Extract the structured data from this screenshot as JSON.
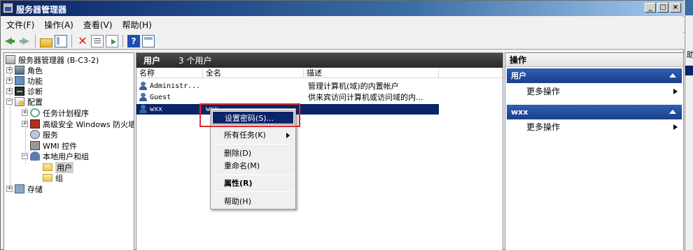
{
  "window": {
    "title": "服务器管理器",
    "buttons": [
      "_",
      "□",
      "×"
    ]
  },
  "menu": [
    "文件(F)",
    "操作(A)",
    "查看(V)",
    "帮助(H)"
  ],
  "toolbar": {
    "icons": [
      "back-icon",
      "forward-icon",
      "up-folder-icon",
      "show-tree-icon",
      "delete-icon",
      "properties-icon",
      "export-list-icon",
      "help-icon",
      "mmc-icon"
    ],
    "help_glyph": "?",
    "delete_glyph": "✕"
  },
  "tree": {
    "root": "服务器管理器 (B-C3-2)",
    "roles": "角色",
    "features": "功能",
    "diagnostics": "诊断",
    "configuration": "配置",
    "task_scheduler": "任务计划程序",
    "firewall": "高级安全 Windows 防火墙",
    "services": "服务",
    "wmi": "WMI 控件",
    "local_users": "本地用户和组",
    "users": "用户",
    "groups": "组",
    "storage": "存储",
    "expand_plus": "+",
    "expand_minus": "−"
  },
  "center": {
    "title": "用户",
    "count": "3 个用户",
    "columns": [
      "名称",
      "全名",
      "描述"
    ],
    "rows": [
      {
        "name": "Administr...",
        "full_name": "",
        "description": "管理计算机(域)的内置帐户"
      },
      {
        "name": "Guest",
        "full_name": "",
        "description": "供来宾访问计算机或访问域的内..."
      },
      {
        "name": "wxx",
        "full_name": "wxx",
        "description": ""
      }
    ]
  },
  "context_menu": {
    "set_password": "设置密码(S)...",
    "all_tasks": "所有任务(K)",
    "delete": "删除(D)",
    "rename": "重命名(M)",
    "properties": "属性(R)",
    "help": "帮助(H)"
  },
  "actions": {
    "title": "操作",
    "sections": [
      {
        "name": "用户",
        "item": "更多操作"
      },
      {
        "name": "wxx",
        "item": "更多操作"
      }
    ]
  },
  "background_window": {
    "visible_text": "助"
  },
  "colors": {
    "highlight_blue": "#0a246a",
    "action_header": "#2e5fb4",
    "annotation_red": "#e0282b"
  }
}
